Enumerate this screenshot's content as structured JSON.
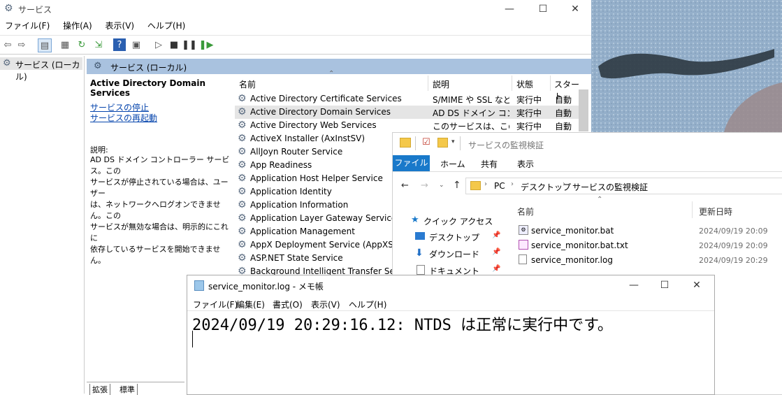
{
  "services": {
    "title": "サービス",
    "menu": [
      "ファイル(F)",
      "操作(A)",
      "表示(V)",
      "ヘルプ(H)"
    ],
    "tree_item": "サービス (ローカル)",
    "pane_title": "サービス (ローカル)",
    "selected_name": "Active Directory Domain Services",
    "links": [
      "サービスの停止",
      "サービスの再起動"
    ],
    "desc_label": "説明:",
    "desc_lines": [
      "AD DS ドメイン コントローラー サービス。この",
      "サービスが停止されている場合は、ユーザー",
      "は、ネットワークへログオンできません。この",
      "サービスが無効な場合は、明示的にこれに",
      "依存しているサービスを開始できません。"
    ],
    "columns": [
      "名前",
      "説明",
      "状態",
      "スタート"
    ],
    "rows": [
      {
        "name": "Active Directory Certificate Services",
        "desc": "S/MIME や SSL など...",
        "status": "実行中",
        "start": "自動"
      },
      {
        "name": "Active Directory Domain Services",
        "desc": "AD DS ドメイン コント...",
        "status": "実行中",
        "start": "自動"
      },
      {
        "name": "Active Directory Web Services",
        "desc": "このサービスは、このサ...",
        "status": "実行中",
        "start": "自動"
      },
      {
        "name": "ActiveX Installer (AxInstSV)",
        "desc": "",
        "status": "",
        "start": ""
      },
      {
        "name": "AllJoyn Router Service",
        "desc": "",
        "status": "",
        "start": ""
      },
      {
        "name": "App Readiness",
        "desc": "",
        "status": "",
        "start": ""
      },
      {
        "name": "Application Host Helper Service",
        "desc": "",
        "status": "",
        "start": ""
      },
      {
        "name": "Application Identity",
        "desc": "",
        "status": "",
        "start": ""
      },
      {
        "name": "Application Information",
        "desc": "",
        "status": "",
        "start": ""
      },
      {
        "name": "Application Layer Gateway Service",
        "desc": "",
        "status": "",
        "start": ""
      },
      {
        "name": "Application Management",
        "desc": "",
        "status": "",
        "start": ""
      },
      {
        "name": "AppX Deployment Service (AppXSVC)",
        "desc": "",
        "status": "",
        "start": ""
      },
      {
        "name": "ASP.NET State Service",
        "desc": "",
        "status": "",
        "start": ""
      },
      {
        "name": "Background Intelligent Transfer Service",
        "desc": "",
        "status": "",
        "start": ""
      }
    ],
    "tabs": [
      "拡張",
      "標準"
    ]
  },
  "explorer": {
    "title": "サービスの監視検証",
    "ribbon": [
      "ファイル",
      "ホーム",
      "共有",
      "表示"
    ],
    "path": [
      "PC",
      "デスクトップ",
      "サービスの監視検証"
    ],
    "nav": [
      "クイック アクセス",
      "デスクトップ",
      "ダウンロード",
      "ドキュメント"
    ],
    "col_name": "名前",
    "col_date": "更新日時",
    "files": [
      {
        "name": "service_monitor.bat",
        "date": "2024/09/19 20:09"
      },
      {
        "name": "service_monitor.bat.txt",
        "date": "2024/09/19 20:09"
      },
      {
        "name": "service_monitor.log",
        "date": "2024/09/19 20:29"
      }
    ]
  },
  "notepad": {
    "title": "service_monitor.log - メモ帳",
    "menu": [
      "ファイル(F)",
      "編集(E)",
      "書式(O)",
      "表示(V)",
      "ヘルプ(H)"
    ],
    "content": "2024/09/19 20:29:16.12: NTDS は正常に実行中です。"
  },
  "colors": {
    "accent": "#1979ca",
    "pane_header": "#a9c2df",
    "selected_row": "#e5e5e5"
  }
}
